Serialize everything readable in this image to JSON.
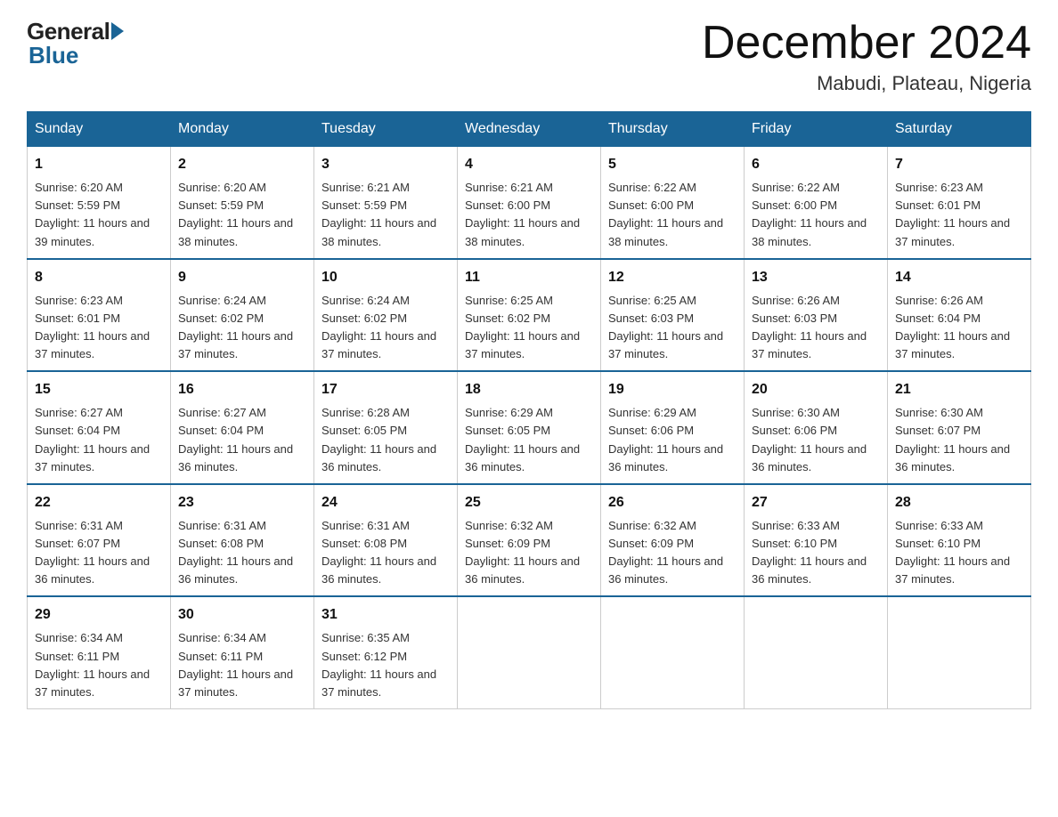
{
  "logo": {
    "general": "General",
    "blue": "Blue"
  },
  "title": {
    "month": "December 2024",
    "location": "Mabudi, Plateau, Nigeria"
  },
  "weekdays": [
    "Sunday",
    "Monday",
    "Tuesday",
    "Wednesday",
    "Thursday",
    "Friday",
    "Saturday"
  ],
  "weeks": [
    [
      {
        "day": 1,
        "sunrise": "6:20 AM",
        "sunset": "5:59 PM",
        "daylight": "11 hours and 39 minutes."
      },
      {
        "day": 2,
        "sunrise": "6:20 AM",
        "sunset": "5:59 PM",
        "daylight": "11 hours and 38 minutes."
      },
      {
        "day": 3,
        "sunrise": "6:21 AM",
        "sunset": "5:59 PM",
        "daylight": "11 hours and 38 minutes."
      },
      {
        "day": 4,
        "sunrise": "6:21 AM",
        "sunset": "6:00 PM",
        "daylight": "11 hours and 38 minutes."
      },
      {
        "day": 5,
        "sunrise": "6:22 AM",
        "sunset": "6:00 PM",
        "daylight": "11 hours and 38 minutes."
      },
      {
        "day": 6,
        "sunrise": "6:22 AM",
        "sunset": "6:00 PM",
        "daylight": "11 hours and 38 minutes."
      },
      {
        "day": 7,
        "sunrise": "6:23 AM",
        "sunset": "6:01 PM",
        "daylight": "11 hours and 37 minutes."
      }
    ],
    [
      {
        "day": 8,
        "sunrise": "6:23 AM",
        "sunset": "6:01 PM",
        "daylight": "11 hours and 37 minutes."
      },
      {
        "day": 9,
        "sunrise": "6:24 AM",
        "sunset": "6:02 PM",
        "daylight": "11 hours and 37 minutes."
      },
      {
        "day": 10,
        "sunrise": "6:24 AM",
        "sunset": "6:02 PM",
        "daylight": "11 hours and 37 minutes."
      },
      {
        "day": 11,
        "sunrise": "6:25 AM",
        "sunset": "6:02 PM",
        "daylight": "11 hours and 37 minutes."
      },
      {
        "day": 12,
        "sunrise": "6:25 AM",
        "sunset": "6:03 PM",
        "daylight": "11 hours and 37 minutes."
      },
      {
        "day": 13,
        "sunrise": "6:26 AM",
        "sunset": "6:03 PM",
        "daylight": "11 hours and 37 minutes."
      },
      {
        "day": 14,
        "sunrise": "6:26 AM",
        "sunset": "6:04 PM",
        "daylight": "11 hours and 37 minutes."
      }
    ],
    [
      {
        "day": 15,
        "sunrise": "6:27 AM",
        "sunset": "6:04 PM",
        "daylight": "11 hours and 37 minutes."
      },
      {
        "day": 16,
        "sunrise": "6:27 AM",
        "sunset": "6:04 PM",
        "daylight": "11 hours and 36 minutes."
      },
      {
        "day": 17,
        "sunrise": "6:28 AM",
        "sunset": "6:05 PM",
        "daylight": "11 hours and 36 minutes."
      },
      {
        "day": 18,
        "sunrise": "6:29 AM",
        "sunset": "6:05 PM",
        "daylight": "11 hours and 36 minutes."
      },
      {
        "day": 19,
        "sunrise": "6:29 AM",
        "sunset": "6:06 PM",
        "daylight": "11 hours and 36 minutes."
      },
      {
        "day": 20,
        "sunrise": "6:30 AM",
        "sunset": "6:06 PM",
        "daylight": "11 hours and 36 minutes."
      },
      {
        "day": 21,
        "sunrise": "6:30 AM",
        "sunset": "6:07 PM",
        "daylight": "11 hours and 36 minutes."
      }
    ],
    [
      {
        "day": 22,
        "sunrise": "6:31 AM",
        "sunset": "6:07 PM",
        "daylight": "11 hours and 36 minutes."
      },
      {
        "day": 23,
        "sunrise": "6:31 AM",
        "sunset": "6:08 PM",
        "daylight": "11 hours and 36 minutes."
      },
      {
        "day": 24,
        "sunrise": "6:31 AM",
        "sunset": "6:08 PM",
        "daylight": "11 hours and 36 minutes."
      },
      {
        "day": 25,
        "sunrise": "6:32 AM",
        "sunset": "6:09 PM",
        "daylight": "11 hours and 36 minutes."
      },
      {
        "day": 26,
        "sunrise": "6:32 AM",
        "sunset": "6:09 PM",
        "daylight": "11 hours and 36 minutes."
      },
      {
        "day": 27,
        "sunrise": "6:33 AM",
        "sunset": "6:10 PM",
        "daylight": "11 hours and 36 minutes."
      },
      {
        "day": 28,
        "sunrise": "6:33 AM",
        "sunset": "6:10 PM",
        "daylight": "11 hours and 37 minutes."
      }
    ],
    [
      {
        "day": 29,
        "sunrise": "6:34 AM",
        "sunset": "6:11 PM",
        "daylight": "11 hours and 37 minutes."
      },
      {
        "day": 30,
        "sunrise": "6:34 AM",
        "sunset": "6:11 PM",
        "daylight": "11 hours and 37 minutes."
      },
      {
        "day": 31,
        "sunrise": "6:35 AM",
        "sunset": "6:12 PM",
        "daylight": "11 hours and 37 minutes."
      },
      null,
      null,
      null,
      null
    ]
  ]
}
